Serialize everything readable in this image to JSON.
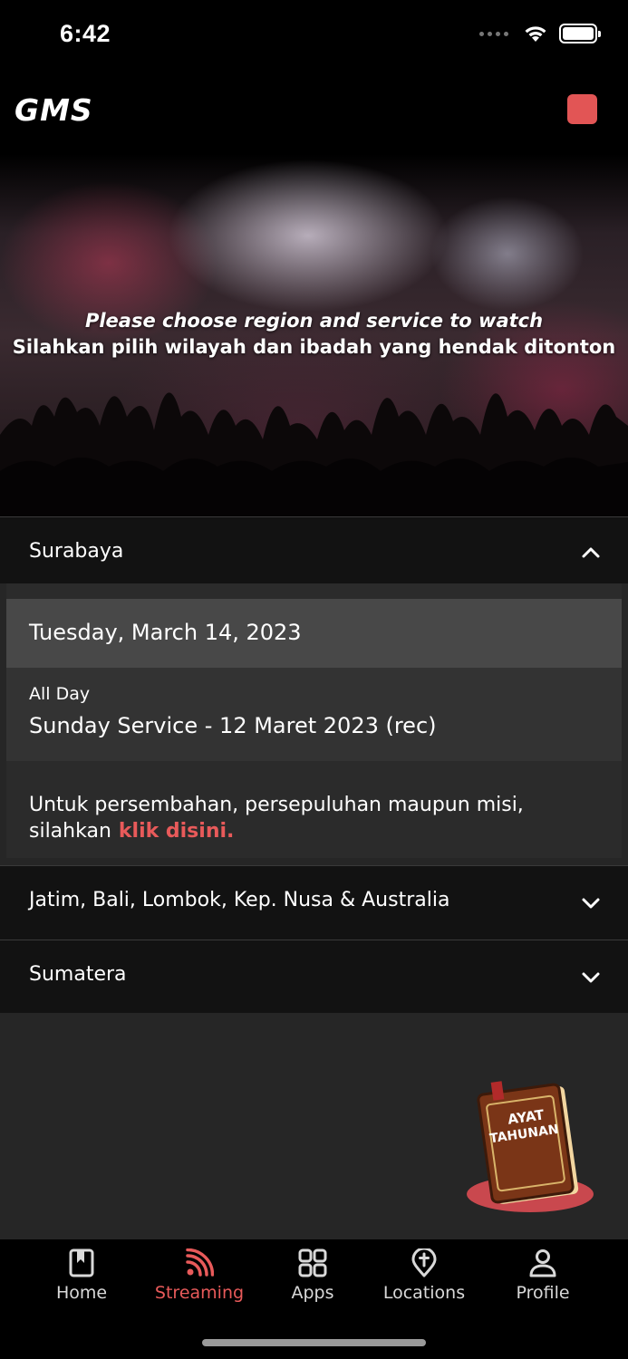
{
  "status_bar": {
    "time": "6:42"
  },
  "header": {
    "logo": "GMS"
  },
  "hero": {
    "line_en": "Please choose region and service to watch",
    "line_id": "Silahkan pilih wilayah dan ibadah yang hendak ditonton"
  },
  "regions": [
    {
      "name": "Surabaya",
      "expanded": true
    },
    {
      "name": "Jatim, Bali, Lombok, Kep. Nusa & Australia",
      "expanded": false
    },
    {
      "name": "Sumatera",
      "expanded": false
    }
  ],
  "schedule": {
    "date": "Tuesday, March 14, 2023",
    "service_time": "All Day",
    "service_title": "Sunday Service - 12 Maret 2023 (rec)"
  },
  "offering": {
    "line1": "Untuk persembahan, persepuluhan maupun misi,",
    "line2": "silahkan",
    "link": "klik disini."
  },
  "fab": {
    "line1": "AYAT",
    "line2": "TAHUNAN"
  },
  "tabs": [
    {
      "label": "Home",
      "icon": "bookmark-book-icon"
    },
    {
      "label": "Streaming",
      "icon": "rss-icon",
      "active": true
    },
    {
      "label": "Apps",
      "icon": "grid-icon"
    },
    {
      "label": "Locations",
      "icon": "location-pin-cross-icon"
    },
    {
      "label": "Profile",
      "icon": "person-icon"
    }
  ],
  "colors": {
    "accent": "#e85a5a",
    "header_action": "#e25555",
    "background": "#262626",
    "region_bar": "#121212"
  }
}
